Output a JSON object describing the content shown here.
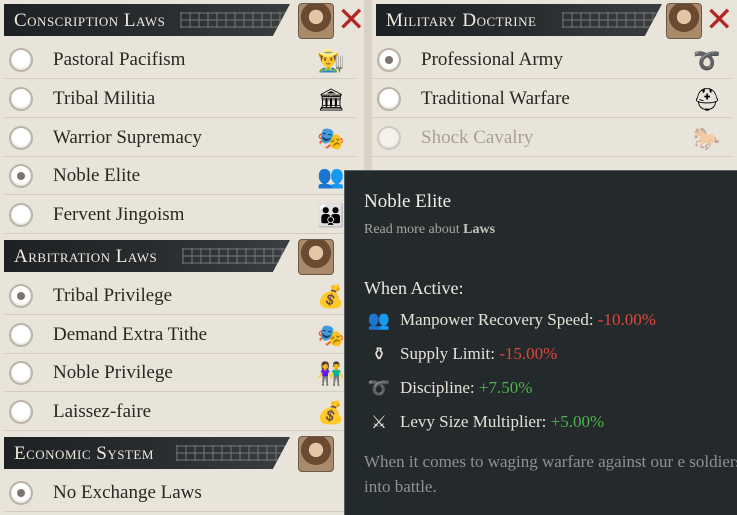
{
  "left": {
    "conscription": {
      "title": "Conscription Laws",
      "items": [
        {
          "label": "Pastoral Pacifism",
          "selected": false,
          "icon": "farmers-icon"
        },
        {
          "label": "Tribal Militia",
          "selected": false,
          "icon": "temple-icon"
        },
        {
          "label": "Warrior Supremacy",
          "selected": false,
          "icon": "masks-icon"
        },
        {
          "label": "Noble Elite",
          "selected": true,
          "icon": "nobles-icon"
        },
        {
          "label": "Fervent Jingoism",
          "selected": false,
          "icon": "crowd-icon"
        }
      ]
    },
    "arbitration": {
      "title": "Arbitration Laws",
      "items": [
        {
          "label": "Tribal Privilege",
          "selected": true,
          "icon": "treasure-icon"
        },
        {
          "label": "Demand Extra Tithe",
          "selected": false,
          "icon": "masks-icon"
        },
        {
          "label": "Noble Privilege",
          "selected": false,
          "icon": "couple-icon"
        },
        {
          "label": "Laissez-faire",
          "selected": false,
          "icon": "treasure-icon"
        }
      ]
    },
    "economic": {
      "title": "Economic System",
      "items": [
        {
          "label": "No Exchange Laws",
          "selected": true,
          "icon": "none"
        }
      ]
    }
  },
  "right": {
    "military": {
      "title": "Military Doctrine",
      "items": [
        {
          "label": "Professional Army",
          "selected": true,
          "disabled": false,
          "icon": "whip-icon"
        },
        {
          "label": "Traditional Warfare",
          "selected": false,
          "disabled": false,
          "icon": "helmet-icon"
        },
        {
          "label": "Shock Cavalry",
          "selected": false,
          "disabled": true,
          "icon": "horse-icon"
        }
      ]
    }
  },
  "tooltip": {
    "title": "Noble Elite",
    "read_more_prefix": "Read more about",
    "read_more_link": "Laws",
    "when_active": "When Active:",
    "effects": [
      {
        "label": "Manpower Recovery Speed:",
        "value": "-10.00%",
        "kind": "neg",
        "icon": "manpower-icon"
      },
      {
        "label": "Supply Limit:",
        "value": "-15.00%",
        "kind": "neg",
        "icon": "supply-pot-icon"
      },
      {
        "label": "Discipline:",
        "value": "+7.50%",
        "kind": "pos",
        "icon": "discipline-whip-icon"
      },
      {
        "label": "Levy Size Multiplier:",
        "value": "+5.00%",
        "kind": "pos",
        "icon": "spear-icon"
      }
    ],
    "description": "When it comes to waging warfare against our e soldiers into battle."
  },
  "colors": {
    "header_bg": "#24272a",
    "close_red": "#b32622",
    "negative": "#e1463b",
    "positive": "#4db34a"
  }
}
